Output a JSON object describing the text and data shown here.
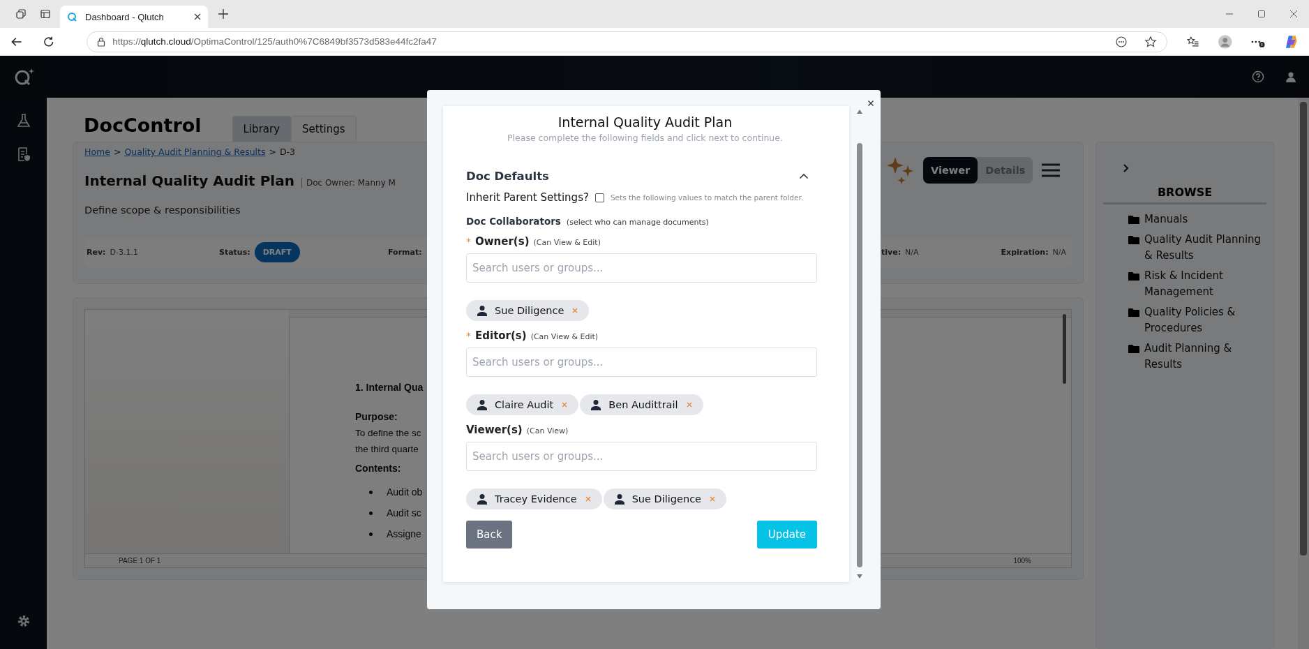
{
  "browser": {
    "tab_title": "Dashboard - Qlutch",
    "url": "https://**qlutch.cloud**/OptimaControl/125/auth0%7C6849bf3573d583e44fc2fa47"
  },
  "app": {
    "title": "DocControl",
    "tabs": [
      {
        "label": "Library",
        "selected": true
      },
      {
        "label": "Settings",
        "selected": false
      }
    ],
    "breadcrumb_separator": ">",
    "breadcrumb": [
      {
        "label": "Home",
        "kind": "link"
      },
      {
        "label": "Quality Audit Planning & Results",
        "kind": "link"
      },
      {
        "label": "D-3",
        "kind": "current"
      }
    ],
    "doc_title": "Internal Quality Audit Plan",
    "doc_owner": "Doc Owner: Manny M",
    "description": "Define scope & responsibilities",
    "meta_left": [
      {
        "label": "Rev:",
        "value": "D-3.1.1",
        "kind": "text"
      },
      {
        "label": "Status:",
        "value": "DRAFT",
        "kind": "badge"
      },
      {
        "label": "Format:"
      }
    ],
    "meta_right": [
      {
        "label": "tive:",
        "value": "N/A"
      },
      {
        "label": "Expiration:",
        "value": "N/A"
      }
    ],
    "view_toggle": [
      {
        "label": "Viewer",
        "selected": true
      },
      {
        "label": "Details",
        "selected": false
      }
    ],
    "preview": [
      {
        "kind": "heading",
        "text": "1. Internal Qua"
      },
      {
        "kind": "label",
        "text": "Purpose:"
      },
      {
        "kind": "line",
        "text": "To define the sc"
      },
      {
        "kind": "line",
        "text": "the third quarte"
      },
      {
        "kind": "label",
        "text": "Contents:"
      },
      {
        "kind": "bullet",
        "text": "Audit ob"
      },
      {
        "kind": "bullet",
        "text": "Audit sc"
      },
      {
        "kind": "bullet",
        "text": "Assigne"
      }
    ],
    "page_indicator": "PAGE 1 OF 1",
    "zoom": "100%"
  },
  "sidebar": {
    "title": "BROWSE",
    "folders": [
      "Manuals",
      "Quality Audit Planning & Results",
      "Risk & Incident Management",
      "Quality Policies & Procedures",
      "Audit Planning & Results"
    ]
  },
  "dialog": {
    "title": "Internal Quality Audit Plan",
    "subtitle": "Please complete the following fields and click next to continue.",
    "section": {
      "title": "Doc Defaults",
      "expanded": true
    },
    "inherit": {
      "label": "Inherit Parent Settings?",
      "checked": false,
      "hint": "Sets the following values to match the parent folder."
    },
    "collaborators": {
      "title": "Doc Collaborators",
      "note": "(select who can manage documents)"
    },
    "required_mark": "*",
    "roles": [
      {
        "label": "Owner(s)",
        "note": "(Can View & Edit)",
        "required": true,
        "placeholder": "Search users or groups...",
        "members": [
          "Sue Diligence"
        ]
      },
      {
        "label": "Editor(s)",
        "note": "(Can View & Edit)",
        "required": true,
        "placeholder": "Search users or groups...",
        "members": [
          "Claire Audit",
          "Ben Audittrail"
        ]
      },
      {
        "label": "Viewer(s)",
        "note": "(Can View)",
        "required": false,
        "placeholder": "Search users or groups...",
        "members": [
          "Tracey Evidence",
          "Sue Diligence"
        ]
      }
    ],
    "buttons": [
      {
        "label": "Back",
        "kind": "secondary"
      },
      {
        "label": "Update",
        "kind": "primary"
      }
    ]
  }
}
